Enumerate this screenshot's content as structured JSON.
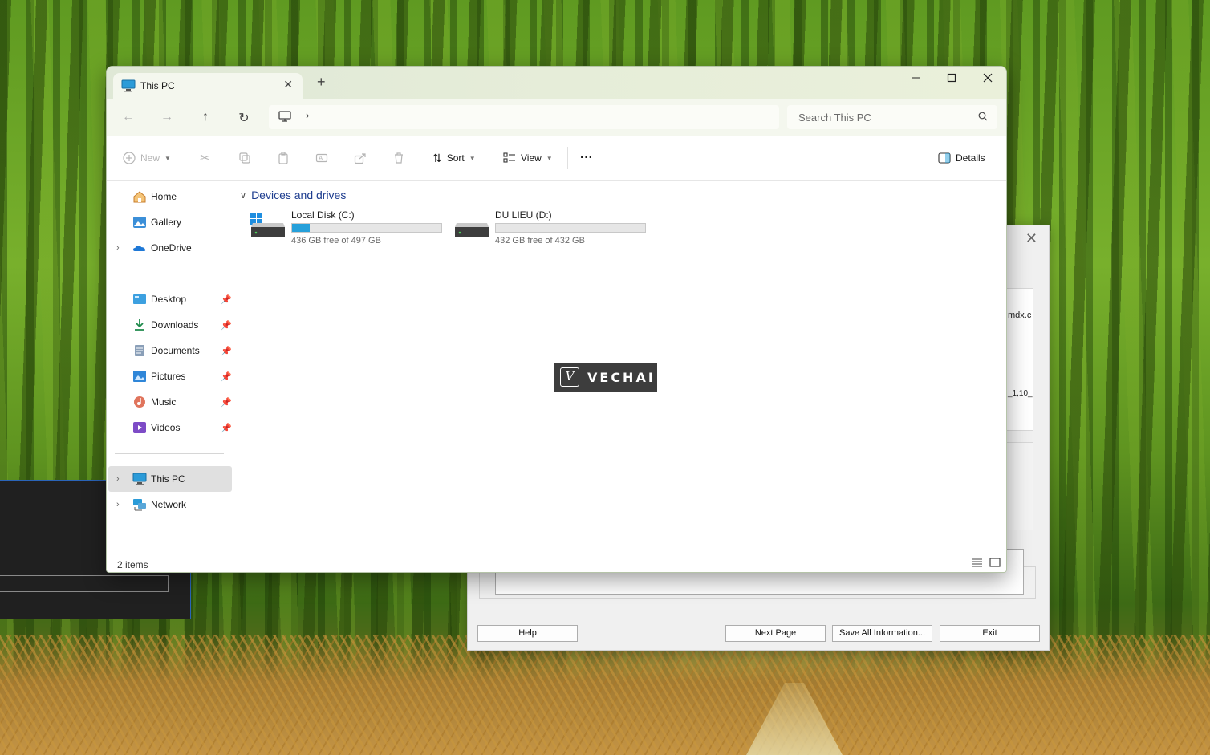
{
  "dialog": {
    "text1": "mdx.c",
    "text2": "_1,10_",
    "buttons": [
      "Help",
      "Next Page",
      "Save All Information...",
      "Exit"
    ]
  },
  "explorer": {
    "tab_title": "This PC",
    "search_placeholder": "Search This PC",
    "toolbar": {
      "new_label": "New",
      "sort_label": "Sort",
      "view_label": "View",
      "details_label": "Details"
    },
    "sidebar": [
      {
        "label": "Home",
        "icon": "home-icon"
      },
      {
        "label": "Gallery",
        "icon": "gallery-icon"
      },
      {
        "label": "OneDrive",
        "icon": "onedrive-icon"
      },
      {
        "label": "Desktop",
        "icon": "desktop-folder-icon"
      },
      {
        "label": "Downloads",
        "icon": "downloads-icon"
      },
      {
        "label": "Documents",
        "icon": "documents-icon"
      },
      {
        "label": "Pictures",
        "icon": "pictures-icon"
      },
      {
        "label": "Music",
        "icon": "music-icon"
      },
      {
        "label": "Videos",
        "icon": "videos-icon"
      },
      {
        "label": "This PC",
        "icon": "this-pc-icon"
      },
      {
        "label": "Network",
        "icon": "network-icon"
      }
    ],
    "group_title": "Devices and drives",
    "drives": [
      {
        "name": "Local Disk (C:)",
        "free_text": "436 GB free of 497 GB",
        "used_fraction": 0.12
      },
      {
        "name": "DU LIEU (D:)",
        "free_text": "432 GB free of 432 GB",
        "used_fraction": 0.0
      }
    ],
    "status": "2 items",
    "accent_color": "#26a0da"
  },
  "watermark": {
    "logo": "V",
    "text": "VECHAI"
  }
}
